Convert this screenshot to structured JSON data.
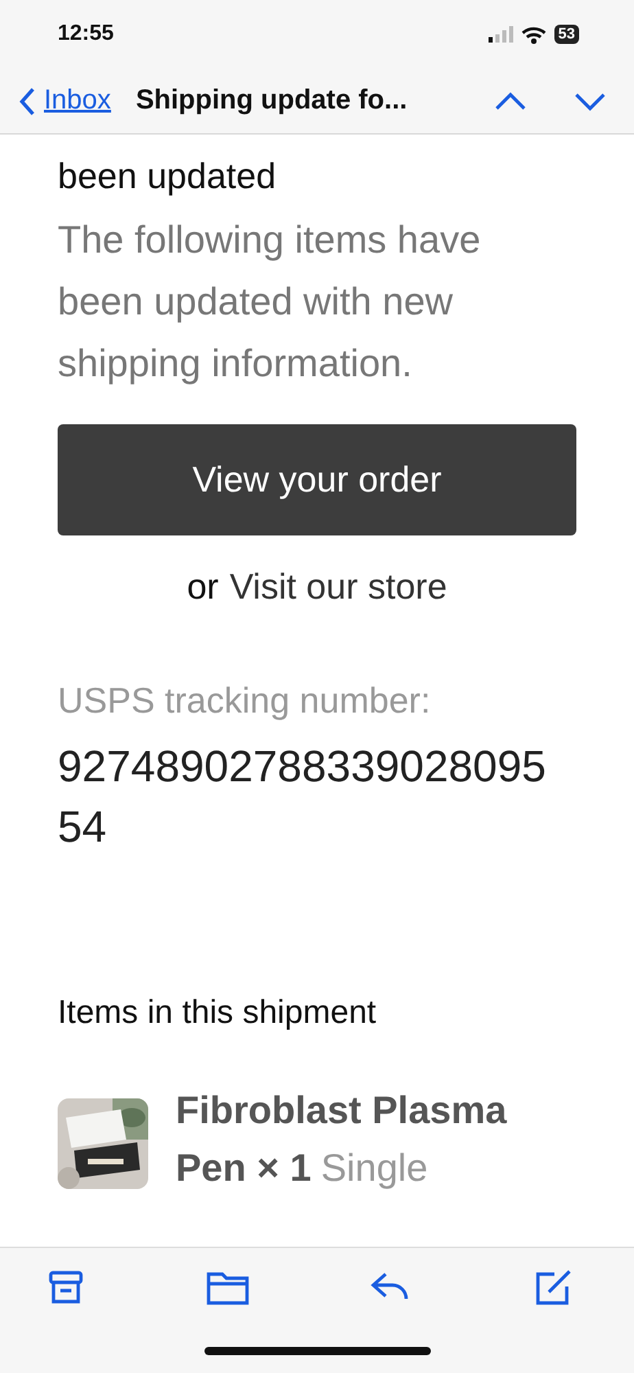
{
  "status_bar": {
    "time": "12:55",
    "battery": "53"
  },
  "nav": {
    "back_label": "Inbox",
    "title": "Shipping update fo..."
  },
  "email": {
    "heading": "been updated",
    "intro": "The following items have been updated with new shipping information.",
    "primary_button": "View your order",
    "secondary_prefix": "or",
    "secondary_link": "Visit our store",
    "tracking_label": "USPS tracking number:",
    "tracking_number": "9274890278833902809554",
    "items_heading": "Items in this shipment",
    "items": [
      {
        "name": "Fibroblast Plasma Pen × 1",
        "variant": "Single",
        "kind": "picture"
      }
    ]
  }
}
